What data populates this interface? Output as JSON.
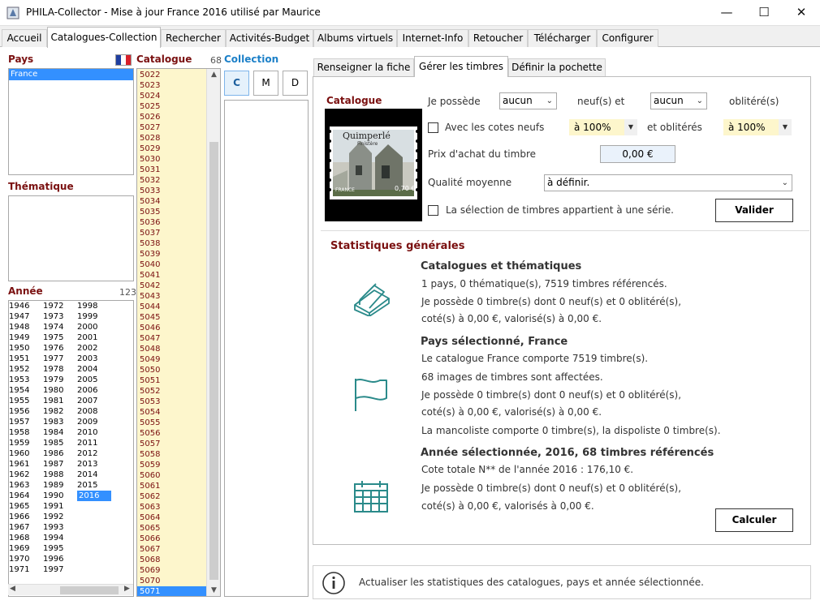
{
  "window": {
    "title": "PHILA-Collector - Mise à jour France 2016 utilisé par Maurice"
  },
  "tabs": [
    "Accueil",
    "Catalogues-Collection",
    "Rechercher",
    "Activités-Budget",
    "Albums virtuels",
    "Internet-Info",
    "Retoucher",
    "Télécharger",
    "Configurer"
  ],
  "left": {
    "pays_title": "Pays",
    "pays_items": [
      "France"
    ],
    "thematique_title": "Thématique",
    "annee_title": "Année",
    "annee_count": "123",
    "years_col1": [
      "1946",
      "1947",
      "1948",
      "1949",
      "1950",
      "1951",
      "1952",
      "1953",
      "1954",
      "1955",
      "1956",
      "1957",
      "1958",
      "1959",
      "1960",
      "1961",
      "1962",
      "1963",
      "1964",
      "1965",
      "1966",
      "1967",
      "1968",
      "1969",
      "1970",
      "1971"
    ],
    "years_col2": [
      "1972",
      "1973",
      "1974",
      "1975",
      "1976",
      "1977",
      "1978",
      "1979",
      "1980",
      "1981",
      "1982",
      "1983",
      "1984",
      "1985",
      "1986",
      "1987",
      "1988",
      "1989",
      "1990",
      "1991",
      "1992",
      "1993",
      "1994",
      "1995",
      "1996",
      "1997"
    ],
    "years_col3": [
      "1998",
      "1999",
      "2000",
      "2001",
      "2002",
      "2003",
      "2004",
      "2005",
      "2006",
      "2007",
      "2008",
      "2009",
      "2010",
      "2011",
      "2012",
      "2013",
      "2014",
      "2015",
      "2016"
    ],
    "selected_year": "2016"
  },
  "catalogue": {
    "title": "Catalogue",
    "count": "68",
    "items": [
      "5022",
      "5023",
      "5024",
      "5025",
      "5026",
      "5027",
      "5028",
      "5029",
      "5030",
      "5031",
      "5032",
      "5033",
      "5034",
      "5035",
      "5036",
      "5037",
      "5038",
      "5039",
      "5040",
      "5041",
      "5042",
      "5043",
      "5044",
      "5045",
      "5046",
      "5047",
      "5048",
      "5049",
      "5050",
      "5051",
      "5052",
      "5053",
      "5054",
      "5055",
      "5056",
      "5057",
      "5058",
      "5059",
      "5060",
      "5061",
      "5062",
      "5063",
      "5064",
      "5065",
      "5066",
      "5067",
      "5068",
      "5069",
      "5070",
      "5071"
    ],
    "selected": "5071"
  },
  "collection": {
    "title": "Collection",
    "buttons": [
      "C",
      "M",
      "D"
    ]
  },
  "right_tabs": [
    "Renseigner la fiche",
    "Gérer les timbres",
    "Définir la pochette"
  ],
  "gerer": {
    "catalogue_label": "Catalogue",
    "stamp": {
      "name": "Quimperlé",
      "sub": "Finistère",
      "country": "FRANCE",
      "value": "0,70 €"
    },
    "je_possede": "Je possède",
    "neuf_select": "aucun",
    "neufs_et": "neuf(s) et",
    "oblit_select": "aucun",
    "obliteres": "oblitéré(s)",
    "avec_cotes": "Avec les cotes neufs",
    "cote_neuf": "à 100%",
    "et_obliteres": "et oblitérés",
    "cote_oblit": "à 100%",
    "prix_label": "Prix d'achat du timbre",
    "prix_value": "0,00 €",
    "qualite_label": "Qualité moyenne",
    "qualite_value": "à définir.",
    "serie_label": "La sélection de timbres appartient à une série.",
    "valider": "Valider"
  },
  "stats": {
    "title": "Statistiques générales",
    "s1": {
      "head": "Catalogues et thématiques",
      "lines": [
        "1 pays, 0 thématique(s), 7519 timbres référencés.",
        "Je possède 0 timbre(s) dont 0 neuf(s) et 0 oblitéré(s),",
        "coté(s) à 0,00 €, valorisé(s) à 0,00 €."
      ]
    },
    "s2": {
      "head": "Pays sélectionné, France",
      "lines": [
        "Le catalogue France comporte 7519 timbre(s).",
        "68 images de timbres sont affectées.",
        "Je possède 0 timbre(s) dont 0 neuf(s) et 0 oblitéré(s),",
        "coté(s) à 0,00 €, valorisé(s) à 0,00 €.",
        "La mancoliste comporte 0 timbre(s), la dispoliste 0 timbre(s)."
      ]
    },
    "s3": {
      "head": "Année sélectionnée, 2016, 68 timbres référencés",
      "lines": [
        "Cote totale N** de l'année 2016 : 176,10 €.",
        "Je possède 0 timbre(s) dont 0 neuf(s) et 0 oblitéré(s),",
        "coté(s) à 0,00 €, valorisés à 0,00 €."
      ]
    },
    "calculer": "Calculer"
  },
  "info": {
    "text": "Actualiser les statistiques des catalogues, pays et année sélectionnée."
  },
  "colors": {
    "accent_red": "#7a1010",
    "accent_blue": "#1c80c8",
    "selection": "#3390ff",
    "catalogue_bg": "#fdf6cc",
    "icon_teal": "#2a8a8a"
  }
}
